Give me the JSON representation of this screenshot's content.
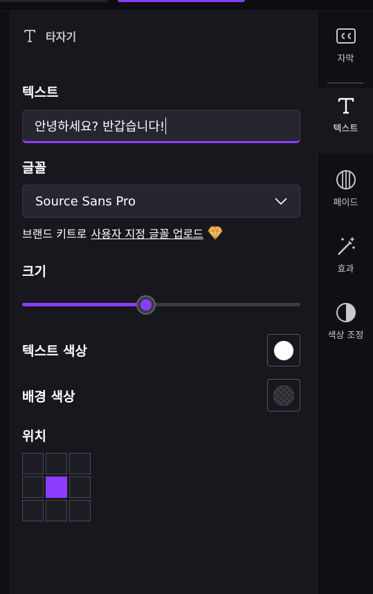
{
  "panel": {
    "title": "타자기"
  },
  "text_section": {
    "label": "텍스트",
    "value": "안녕하세요? 반갑습니다!"
  },
  "font_section": {
    "label": "글꼴",
    "selected": "Source Sans Pro",
    "upload_prefix": "브랜드 키트로",
    "upload_link": "사용자 지정 글꼴 업로드"
  },
  "size_section": {
    "label": "크기",
    "value_fraction": 0.445
  },
  "text_color": {
    "label": "텍스트 색상",
    "color": "#ffffff"
  },
  "bg_color": {
    "label": "배경 색상",
    "color": "transparent"
  },
  "position_section": {
    "label": "위치",
    "selected_cell": 4
  },
  "rail": {
    "items": [
      {
        "label": "자막",
        "icon": "cc-icon"
      },
      {
        "label": "텍스트",
        "icon": "text-icon"
      },
      {
        "label": "페이드",
        "icon": "fade-icon"
      },
      {
        "label": "효과",
        "icon": "magic-wand-icon"
      },
      {
        "label": "색상 조정",
        "icon": "contrast-icon"
      }
    ],
    "active_index": 1
  },
  "colors": {
    "accent": "#8b3dff",
    "panel_bg": "#17171d",
    "app_bg": "#0f0f14"
  }
}
